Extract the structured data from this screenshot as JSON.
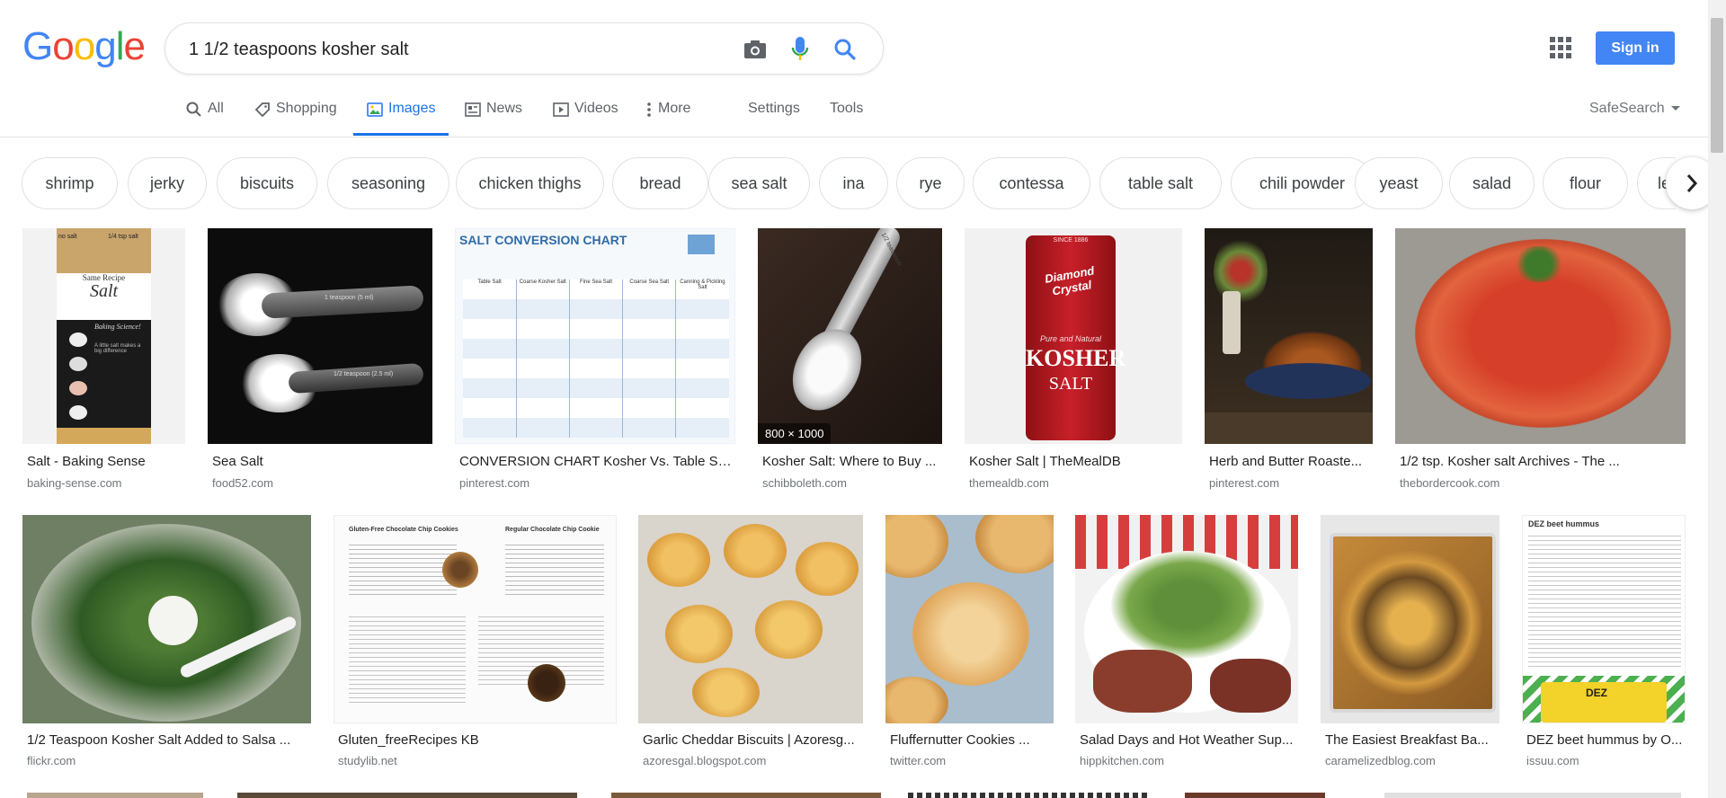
{
  "brand": {
    "logo_letters": [
      "G",
      "o",
      "o",
      "g",
      "l",
      "e"
    ],
    "logo_colors": [
      "#4285F4",
      "#EA4335",
      "#FBBC05",
      "#4285F4",
      "#34A853",
      "#EA4335"
    ]
  },
  "search": {
    "query": "1 1/2 teaspoons kosher salt",
    "icons": [
      "camera-icon",
      "mic-icon",
      "search-icon"
    ]
  },
  "header": {
    "signin_label": "Sign in",
    "apps_icon": "apps-grid-icon"
  },
  "tabs": [
    {
      "label": "All",
      "icon": "search-icon"
    },
    {
      "label": "Shopping",
      "icon": "tag-icon"
    },
    {
      "label": "Images",
      "icon": "image-icon",
      "active": true
    },
    {
      "label": "News",
      "icon": "news-icon"
    },
    {
      "label": "Videos",
      "icon": "play-icon"
    },
    {
      "label": "More",
      "icon": "more-vert-icon"
    }
  ],
  "tools": {
    "settings": "Settings",
    "tools": "Tools",
    "safesearch": "SafeSearch"
  },
  "chips": [
    "shrimp",
    "jerky",
    "biscuits",
    "seasoning",
    "chicken thighs",
    "bread",
    "sea salt",
    "ina",
    "rye",
    "contessa",
    "table salt",
    "chili powder",
    "yeast",
    "salad",
    "flour",
    "le"
  ],
  "results_row1": [
    {
      "caption": "Salt - Baking Sense",
      "source": "baking-sense.com"
    },
    {
      "caption": "Sea Salt",
      "source": "food52.com"
    },
    {
      "caption": "CONVERSION CHART Kosher Vs. Table Sa...",
      "source": "pinterest.com"
    },
    {
      "caption": "Kosher Salt: Where to Buy ...",
      "source": "schibboleth.com",
      "dimensions": "800 × 1000"
    },
    {
      "caption": "Kosher Salt | TheMealDB",
      "source": "themealdb.com"
    },
    {
      "caption": "Herb and Butter Roaste...",
      "source": "pinterest.com"
    },
    {
      "caption": "1/2 tsp. Kosher salt Archives - The ...",
      "source": "thebordercook.com"
    }
  ],
  "results_row2": [
    {
      "caption": "1/2 Teaspoon Kosher Salt Added to Salsa ...",
      "source": "flickr.com"
    },
    {
      "caption": "Gluten_freeRecipes KB",
      "source": "studylib.net"
    },
    {
      "caption": "Garlic Cheddar Biscuits | Azoresg...",
      "source": "azoresgal.blogspot.com"
    },
    {
      "caption": "Fluffernutter Cookies ...",
      "source": "twitter.com"
    },
    {
      "caption": "Salad Days and Hot Weather Sup...",
      "source": "hippkitchen.com"
    },
    {
      "caption": "The Easiest Breakfast Ba...",
      "source": "caramelizedblog.com"
    },
    {
      "caption": "DEZ beet hummus by O...",
      "source": "issuu.com"
    }
  ],
  "image_text": {
    "baking_top_left": "no salt",
    "baking_top_right": "1/4 tsp salt",
    "baking_title1": "Same Recipe",
    "baking_title2": "Salt",
    "baking_title3": "Baking Science!",
    "baking_title4": "A little salt makes a big difference",
    "spoon1": "1 teaspoon (5 ml)",
    "spoon2": "1/2 teaspoon (2.5 ml)",
    "chart_title": "SALT CONVERSION CHART",
    "chart_headers": [
      "Table Salt",
      "Coarse Kosher Salt",
      "Fine Sea Salt",
      "Coarse Sea Salt",
      "Canning & Pickling Salt"
    ],
    "tin_brand": "Diamond Crystal",
    "tin_since": "SINCE 1886",
    "tin_sub": "Pure and Natural",
    "tin_kosher": "KOSHER",
    "tin_salt": "SALT",
    "spoon_engraving": "1/2 teaspoon",
    "cookie_doc_left": "Gluten-Free Chocolate Chip Cookies",
    "cookie_doc_right": "Regular Chocolate Chip Cookie",
    "hummus_title": "DEZ beet hummus",
    "hummus_logo": "DEZ"
  }
}
